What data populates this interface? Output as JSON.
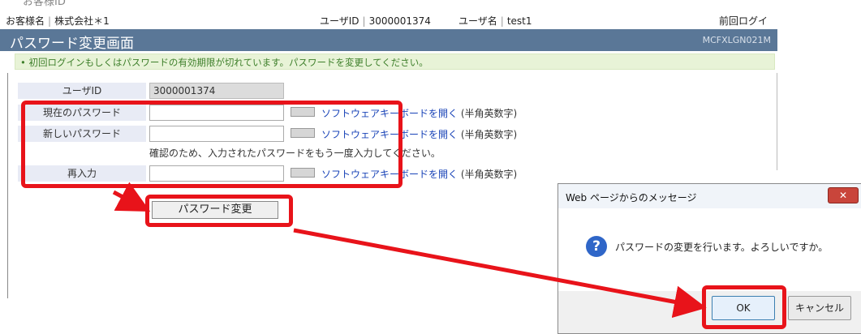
{
  "top_cut_text": "お客様ID",
  "info": {
    "customer_label": "お客様名",
    "customer_value": "株式会社＊1",
    "user_id_label": "ユーザID",
    "user_id_value": "3000001374",
    "user_name_label": "ユーザ名",
    "user_name_value": "test1",
    "last_login": "前回ログイ"
  },
  "header": {
    "title": "パスワード変更画面",
    "screen_code": "MCFXLGN021M"
  },
  "notice": "• 初回ログインもしくはパスワードの有効期限が切れています。パスワードを変更してください。",
  "form": {
    "user_id_label": "ユーザID",
    "user_id_value": "3000001374",
    "current_label": "現在のパスワード",
    "new_label": "新しいパスワード",
    "reenter_label": "再入力",
    "keyboard_link": "ソフトウェアキーボードを開く",
    "keyboard_note": "(半角英数字)",
    "confirm_help": "確認のため、入力されたパスワードをもう一度入力してください。",
    "submit_label": "パスワード変更"
  },
  "dialog": {
    "title": "Web ページからのメッセージ",
    "close_glyph": "✕",
    "message": "パスワードの変更を行います。よろしいですか。",
    "ok_label": "OK",
    "cancel_label": "キャンセル",
    "icon": "question-icon"
  },
  "colors": {
    "header": "#5a7797",
    "notice_bg": "#e8f3d7",
    "highlight": "#e8131a",
    "link": "#1a44b8"
  }
}
